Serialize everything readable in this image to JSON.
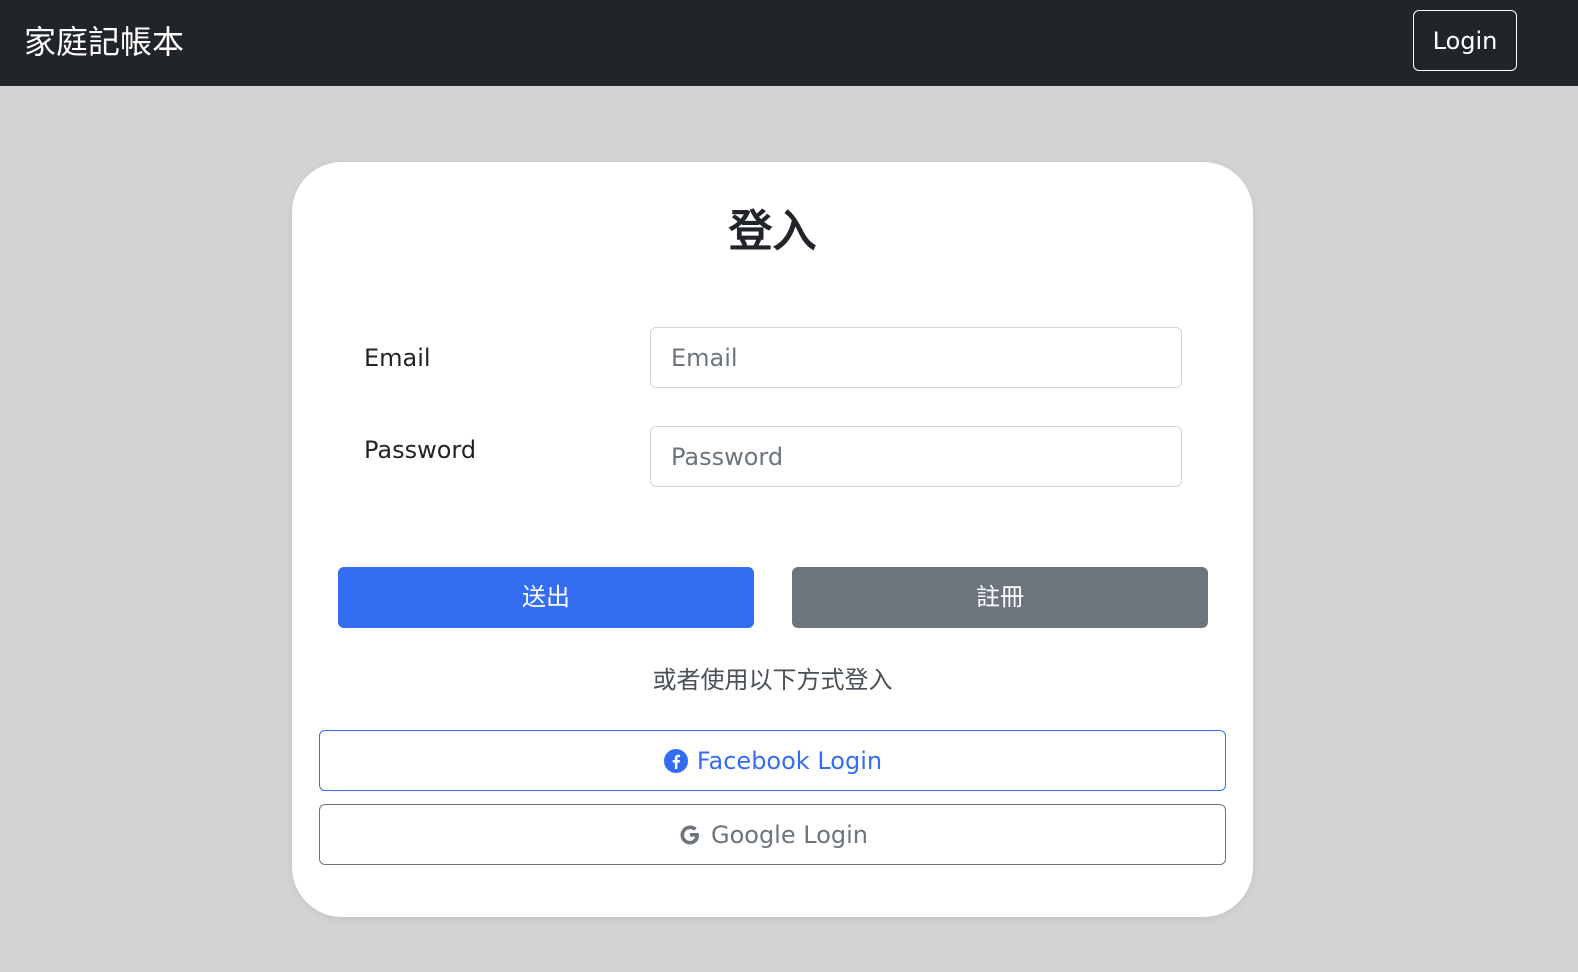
{
  "navbar": {
    "brand": "家庭記帳本",
    "login_label": "Login"
  },
  "card": {
    "title": "登入",
    "email": {
      "label": "Email",
      "placeholder": "Email",
      "value": ""
    },
    "password": {
      "label": "Password",
      "placeholder": "Password",
      "value": ""
    },
    "submit_label": "送出",
    "register_label": "註冊",
    "alt_login_text": "或者使用以下方式登入",
    "facebook_label": "Facebook Login",
    "google_label": "Google Login"
  },
  "colors": {
    "navbar_bg": "#212529",
    "page_bg": "#d3d3d3",
    "primary": "#346df2",
    "secondary": "#6c757d"
  },
  "icons": {
    "facebook": "facebook-icon",
    "google": "google-icon"
  }
}
